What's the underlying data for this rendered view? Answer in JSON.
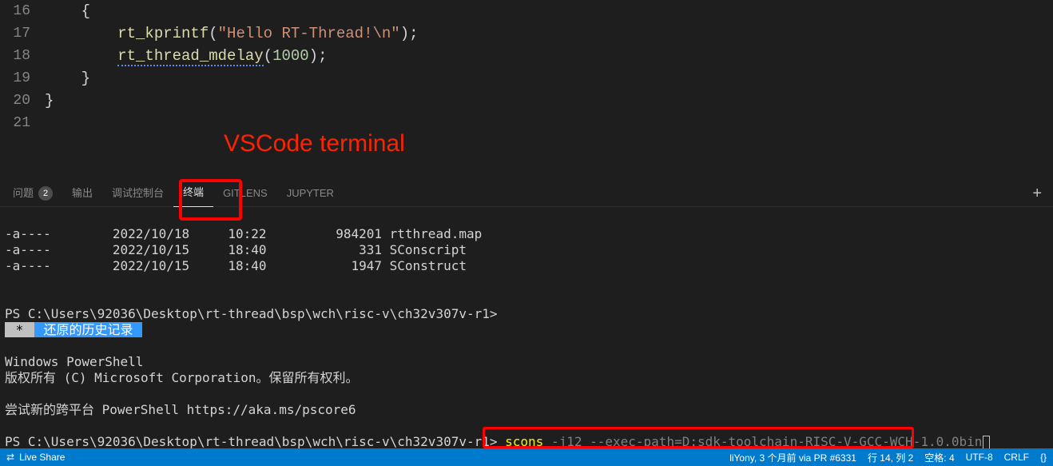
{
  "editor": {
    "lines": [
      {
        "num": 16,
        "indent": "    ",
        "tokens": [
          {
            "t": "{",
            "c": "punc"
          }
        ]
      },
      {
        "num": 17,
        "indent": "        ",
        "tokens": [
          {
            "t": "rt_kprintf",
            "c": "func"
          },
          {
            "t": "(",
            "c": "punc"
          },
          {
            "t": "\"Hello RT-Thread!\\n\"",
            "c": "str"
          },
          {
            "t": ");",
            "c": "punc"
          }
        ]
      },
      {
        "num": 18,
        "indent": "        ",
        "tokens": [
          {
            "t": "rt_thread_mdelay",
            "c": "func",
            "squiggle": true
          },
          {
            "t": "(",
            "c": "punc"
          },
          {
            "t": "1000",
            "c": "num"
          },
          {
            "t": ");",
            "c": "punc"
          }
        ]
      },
      {
        "num": 19,
        "indent": "    ",
        "tokens": [
          {
            "t": "}",
            "c": "punc"
          }
        ]
      },
      {
        "num": 20,
        "indent": "",
        "tokens": [
          {
            "t": "}",
            "c": "punc"
          }
        ]
      },
      {
        "num": 21,
        "indent": "",
        "tokens": []
      }
    ]
  },
  "annotation": {
    "label": "VSCode terminal"
  },
  "panel": {
    "tabs": [
      {
        "id": "problems",
        "label": "问题",
        "badge": "2"
      },
      {
        "id": "output",
        "label": "输出"
      },
      {
        "id": "debug",
        "label": "调试控制台"
      },
      {
        "id": "terminal",
        "label": "终端",
        "active": true
      },
      {
        "id": "gitlens",
        "label": "GITLENS"
      },
      {
        "id": "jupyter",
        "label": "JUPYTER"
      }
    ]
  },
  "terminal": {
    "listing": [
      "-a----        2022/10/18     10:22         984201 rtthread.map",
      "-a----        2022/10/15     18:40            331 SConscript",
      "-a----        2022/10/15     18:40           1947 SConstruct"
    ],
    "prompt1": "PS C:\\Users\\92036\\Desktop\\rt-thread\\bsp\\wch\\risc-v\\ch32v307v-r1>",
    "history_badge": "还原的历史记录",
    "ps_header1": "Windows PowerShell",
    "ps_header2": "版权所有 (C) Microsoft Corporation。保留所有权利。",
    "ps_try": "尝试新的跨平台 PowerShell https://aka.ms/pscore6",
    "prompt2_prefix": "PS C:\\Users\\92036\\Desktop\\rt-thread\\bsp\\wch\\risc-v\\ch32v307v-r1>",
    "cmd_main": "scons",
    "cmd_args": " -j12 --exec-path=D:sdk-toolchain-RISC-V-GCC-WCH-1.0.0bin"
  },
  "status": {
    "left": "Live Share",
    "right_items": [
      "liYony, 3 个月前 via PR #6331",
      "行 14, 列 2",
      "空格: 4",
      "UTF-8",
      "CRLF",
      "{}"
    ]
  }
}
